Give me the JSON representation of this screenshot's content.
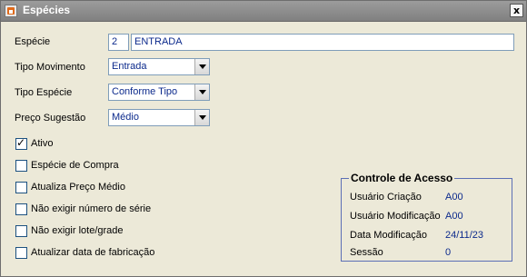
{
  "window": {
    "title": "Espécies",
    "close_label": "x"
  },
  "fields": {
    "especie": {
      "label": "Espécie",
      "code": "2",
      "name": "ENTRADA"
    },
    "tipo_movimento": {
      "label": "Tipo Movimento",
      "value": "Entrada"
    },
    "tipo_especie": {
      "label": "Tipo Espécie",
      "value": "Conforme Tipo"
    },
    "preco_sugestao": {
      "label": "Preço Sugestão",
      "value": "Médio"
    }
  },
  "checkboxes": [
    {
      "label": "Ativo",
      "checked": true
    },
    {
      "label": "Espécie de Compra",
      "checked": false
    },
    {
      "label": "Atualiza Preço Médio",
      "checked": false
    },
    {
      "label": "Não exigir número de série",
      "checked": false
    },
    {
      "label": "Não exigir lote/grade",
      "checked": false
    },
    {
      "label": "Atualizar data de fabricação",
      "checked": false
    }
  ],
  "access_control": {
    "title": "Controle de Acesso",
    "rows": [
      {
        "label": "Usuário Criação",
        "value": "A00"
      },
      {
        "label": "Usuário Modificação",
        "value": "A00"
      },
      {
        "label": "Data Modificação",
        "value": "24/11/23"
      },
      {
        "label": "Sessão",
        "value": "0"
      }
    ]
  }
}
